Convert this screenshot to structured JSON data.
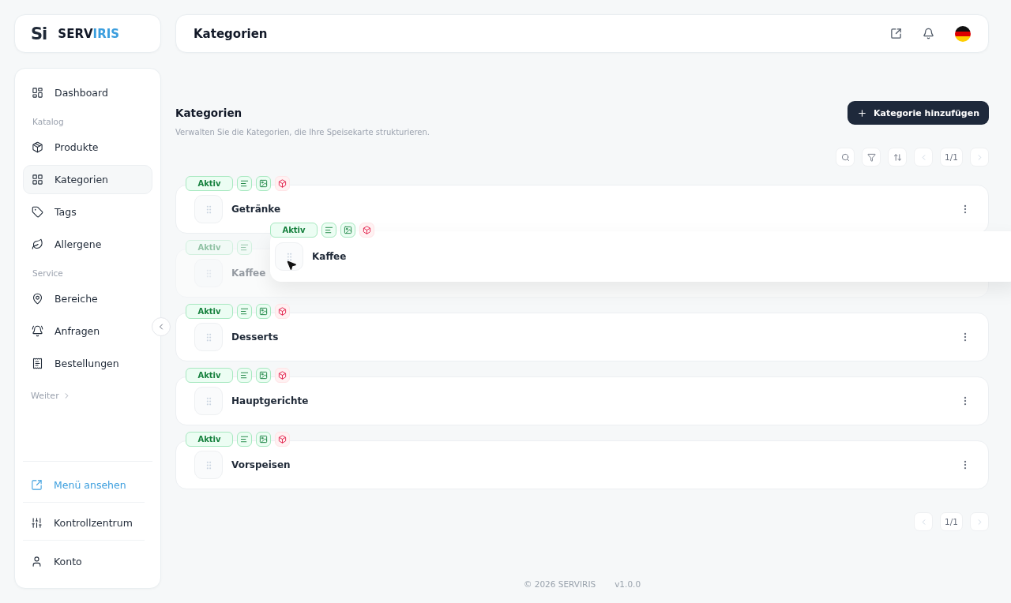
{
  "brand": {
    "mark": "Si",
    "name_start": "SERV",
    "name_end": "IRIS"
  },
  "header": {
    "title": "Kategorien"
  },
  "sidebar": {
    "items": [
      {
        "kind": "item",
        "label": "Dashboard",
        "selected": false
      },
      {
        "kind": "section",
        "label": "Katalog"
      },
      {
        "kind": "item",
        "label": "Produkte",
        "selected": false
      },
      {
        "kind": "item",
        "label": "Kategorien",
        "selected": true
      },
      {
        "kind": "item",
        "label": "Tags",
        "selected": false
      },
      {
        "kind": "item",
        "label": "Allergene",
        "selected": false
      },
      {
        "kind": "section",
        "label": "Service"
      },
      {
        "kind": "item",
        "label": "Bereiche",
        "selected": false
      },
      {
        "kind": "item",
        "label": "Anfragen",
        "selected": false
      },
      {
        "kind": "item",
        "label": "Bestellungen",
        "selected": false
      },
      {
        "kind": "more",
        "label": "Weiter"
      }
    ],
    "bottom": [
      {
        "kind": "link",
        "label": "Menü ansehen"
      },
      {
        "kind": "item",
        "label": "Kontrollzentrum"
      },
      {
        "kind": "item",
        "label": "Konto"
      }
    ]
  },
  "page": {
    "title": "Kategorien",
    "subtitle": "Verwalten Sie die Kategorien, die Ihre Speisekarte strukturieren.",
    "add_button": "Kategorie hinzufügen",
    "page_top": "1/1",
    "page_bottom": "1/1"
  },
  "categories": [
    {
      "kind": "card",
      "name": "Getränke",
      "status": "Aktiv",
      "active": true
    },
    {
      "kind": "placeholder",
      "name": "Kaffee",
      "status": "Aktiv",
      "active": true
    },
    {
      "kind": "card",
      "name": "Desserts",
      "status": "Aktiv",
      "active": true
    },
    {
      "kind": "card",
      "name": "Hauptgerichte",
      "status": "Aktiv",
      "active": true
    },
    {
      "kind": "card",
      "name": "Vorspeisen",
      "status": "Aktiv",
      "active": true
    }
  ],
  "dragging": {
    "name": "Kaffee",
    "status": "Aktiv",
    "active": true
  },
  "footer": {
    "copyright": "© 2026 SERVIRIS",
    "version": "v1.0.0"
  }
}
